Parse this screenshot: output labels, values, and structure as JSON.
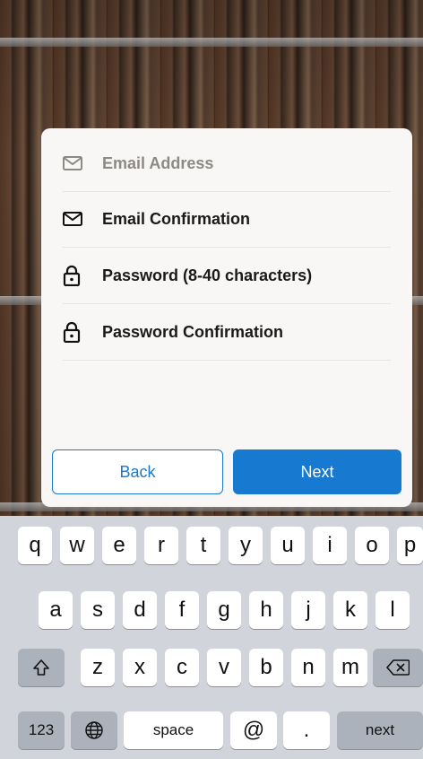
{
  "form": {
    "fields": [
      {
        "label": "Email Address",
        "icon": "envelope-icon",
        "muted": true
      },
      {
        "label": "Email Confirmation",
        "icon": "envelope-icon",
        "muted": false
      },
      {
        "label": "Password (8-40 characters)",
        "icon": "lock-icon",
        "muted": false
      },
      {
        "label": "Password Confirmation",
        "icon": "lock-icon",
        "muted": false
      }
    ],
    "back_label": "Back",
    "next_label": "Next"
  },
  "keyboard": {
    "row1": [
      "q",
      "w",
      "e",
      "r",
      "t",
      "y",
      "u",
      "i",
      "o",
      "p"
    ],
    "row2": [
      "a",
      "s",
      "d",
      "f",
      "g",
      "h",
      "j",
      "k",
      "l"
    ],
    "row3": [
      "z",
      "x",
      "c",
      "v",
      "b",
      "n",
      "m"
    ],
    "numbers_label": "123",
    "space_label": "space",
    "at_label": "@",
    "dot_label": ".",
    "next_label": "next"
  },
  "colors": {
    "accent": "#1779cf",
    "card": "#f8f7f5",
    "keyboard_bg": "#d1d4da"
  }
}
